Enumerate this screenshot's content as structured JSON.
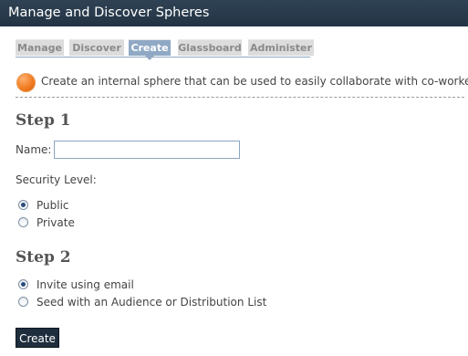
{
  "title": "Manage and Discover Spheres",
  "tabs": [
    {
      "label": "Manage"
    },
    {
      "label": "Discover"
    },
    {
      "label": "Create"
    },
    {
      "label": "Glassboard"
    },
    {
      "label": "Administer"
    }
  ],
  "active_tab": "Create",
  "intro_text": "Create an internal sphere that can be used to easily collaborate with co-workers.",
  "step1": {
    "heading": "Step 1",
    "name_label": "Name:",
    "name_value": "",
    "security_label": "Security Level:",
    "options": [
      {
        "label": "Public",
        "checked": true
      },
      {
        "label": "Private",
        "checked": false
      }
    ]
  },
  "step2": {
    "heading": "Step 2",
    "options": [
      {
        "label": "Invite using email",
        "checked": true
      },
      {
        "label": "Seed with an Audience or Distribution List",
        "checked": false
      }
    ]
  },
  "create_button": "Create",
  "colors": {
    "titlebar": "#2a3b4c",
    "active_tab": "#8fa9c4",
    "accent_icon": "#f07a1e"
  }
}
